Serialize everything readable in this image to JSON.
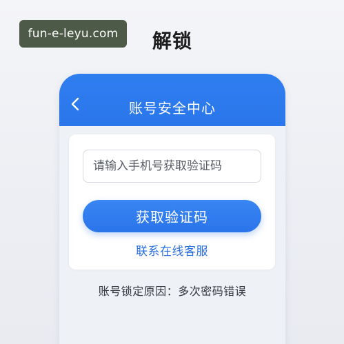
{
  "watermark": {
    "text": "fun-e-leyu.com"
  },
  "page": {
    "heading": "解锁"
  },
  "header": {
    "back_icon": "chevron-left-icon",
    "title": "账号安全中心"
  },
  "form": {
    "phone_placeholder": "请输入手机号获取验证码",
    "phone_value": "",
    "get_code_label": "获取验证码",
    "support_link": "联系在线客服"
  },
  "status": {
    "lock_reason": "账号锁定原因：多次密码错误"
  },
  "colors": {
    "accent": "#2a76ea",
    "link": "#2a6fe0",
    "watermark_bg": "#4e5a48",
    "panel_bg": "#eef1f6"
  }
}
